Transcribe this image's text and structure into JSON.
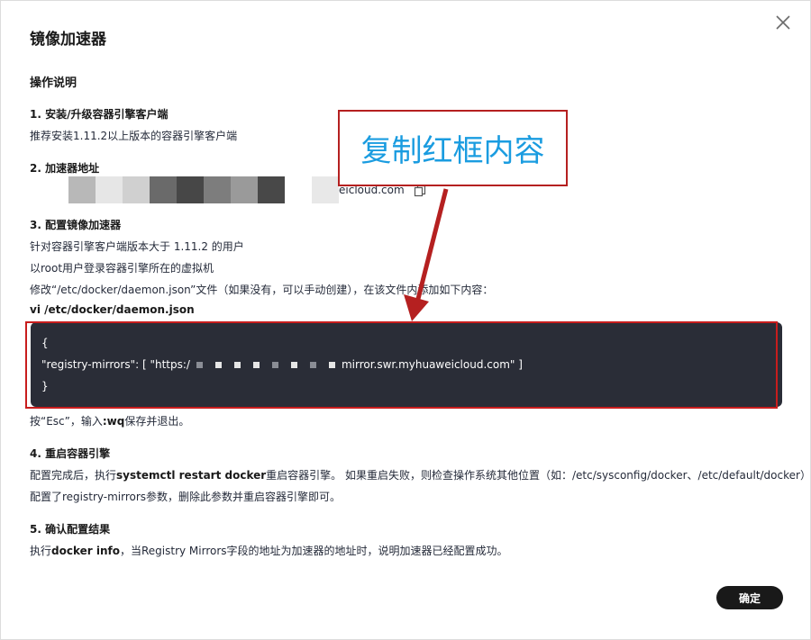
{
  "dialog": {
    "title": "镜像加速器",
    "close_icon": "close-icon",
    "section_title": "操作说明",
    "confirm_label": "确定"
  },
  "step1": {
    "title": "1. 安装/升级容器引擎客户端",
    "desc": "推荐安装1.11.2以上版本的容器引擎客户端"
  },
  "step2": {
    "title": "2. 加速器地址",
    "address_visible_suffix": "eicloud.com",
    "copy_icon": "copy-icon"
  },
  "step3": {
    "title": "3. 配置镜像加速器",
    "line1": "针对容器引擎客户端版本大于 1.11.2 的用户",
    "line2": "以root用户登录容器引擎所在的虚拟机",
    "line3": "修改“/etc/docker/daemon.json”文件（如果没有，可以手动创建），在该文件内添加如下内容：",
    "cmd": "vi /etc/docker/daemon.json",
    "code_open": "{",
    "code_key_prefix": "\"registry-mirrors\": [ \"https:/",
    "code_value_suffix": "mirror.swr.myhuaweicloud.com\" ]",
    "code_close": "}",
    "after_prefix": "按“Esc”，输入",
    "after_bold": ":wq",
    "after_suffix": "保存并退出。"
  },
  "step4": {
    "title": "4. 重启容器引擎",
    "line1_prefix": "配置完成后，执行",
    "line1_bold": "systemctl restart docker",
    "line1_suffix": "重启容器引擎。 如果重启失败，则检查操作系统其他位置（如：/etc/sysconfig/docker、/etc/default/docker）是否",
    "line2": "配置了registry-mirrors参数，删除此参数并重启容器引擎即可。"
  },
  "step5": {
    "title": "5. 确认配置结果",
    "line_prefix": "执行",
    "line_bold": "docker info",
    "line_suffix": "，当Registry Mirrors字段的地址为加速器的地址时，说明加速器已经配置成功。"
  },
  "annotation": {
    "callout_text": "复制红框内容",
    "colors": {
      "outline": "#c81d1d",
      "callout_text": "#1a9ce0",
      "code_bg": "#2a2d37"
    }
  }
}
